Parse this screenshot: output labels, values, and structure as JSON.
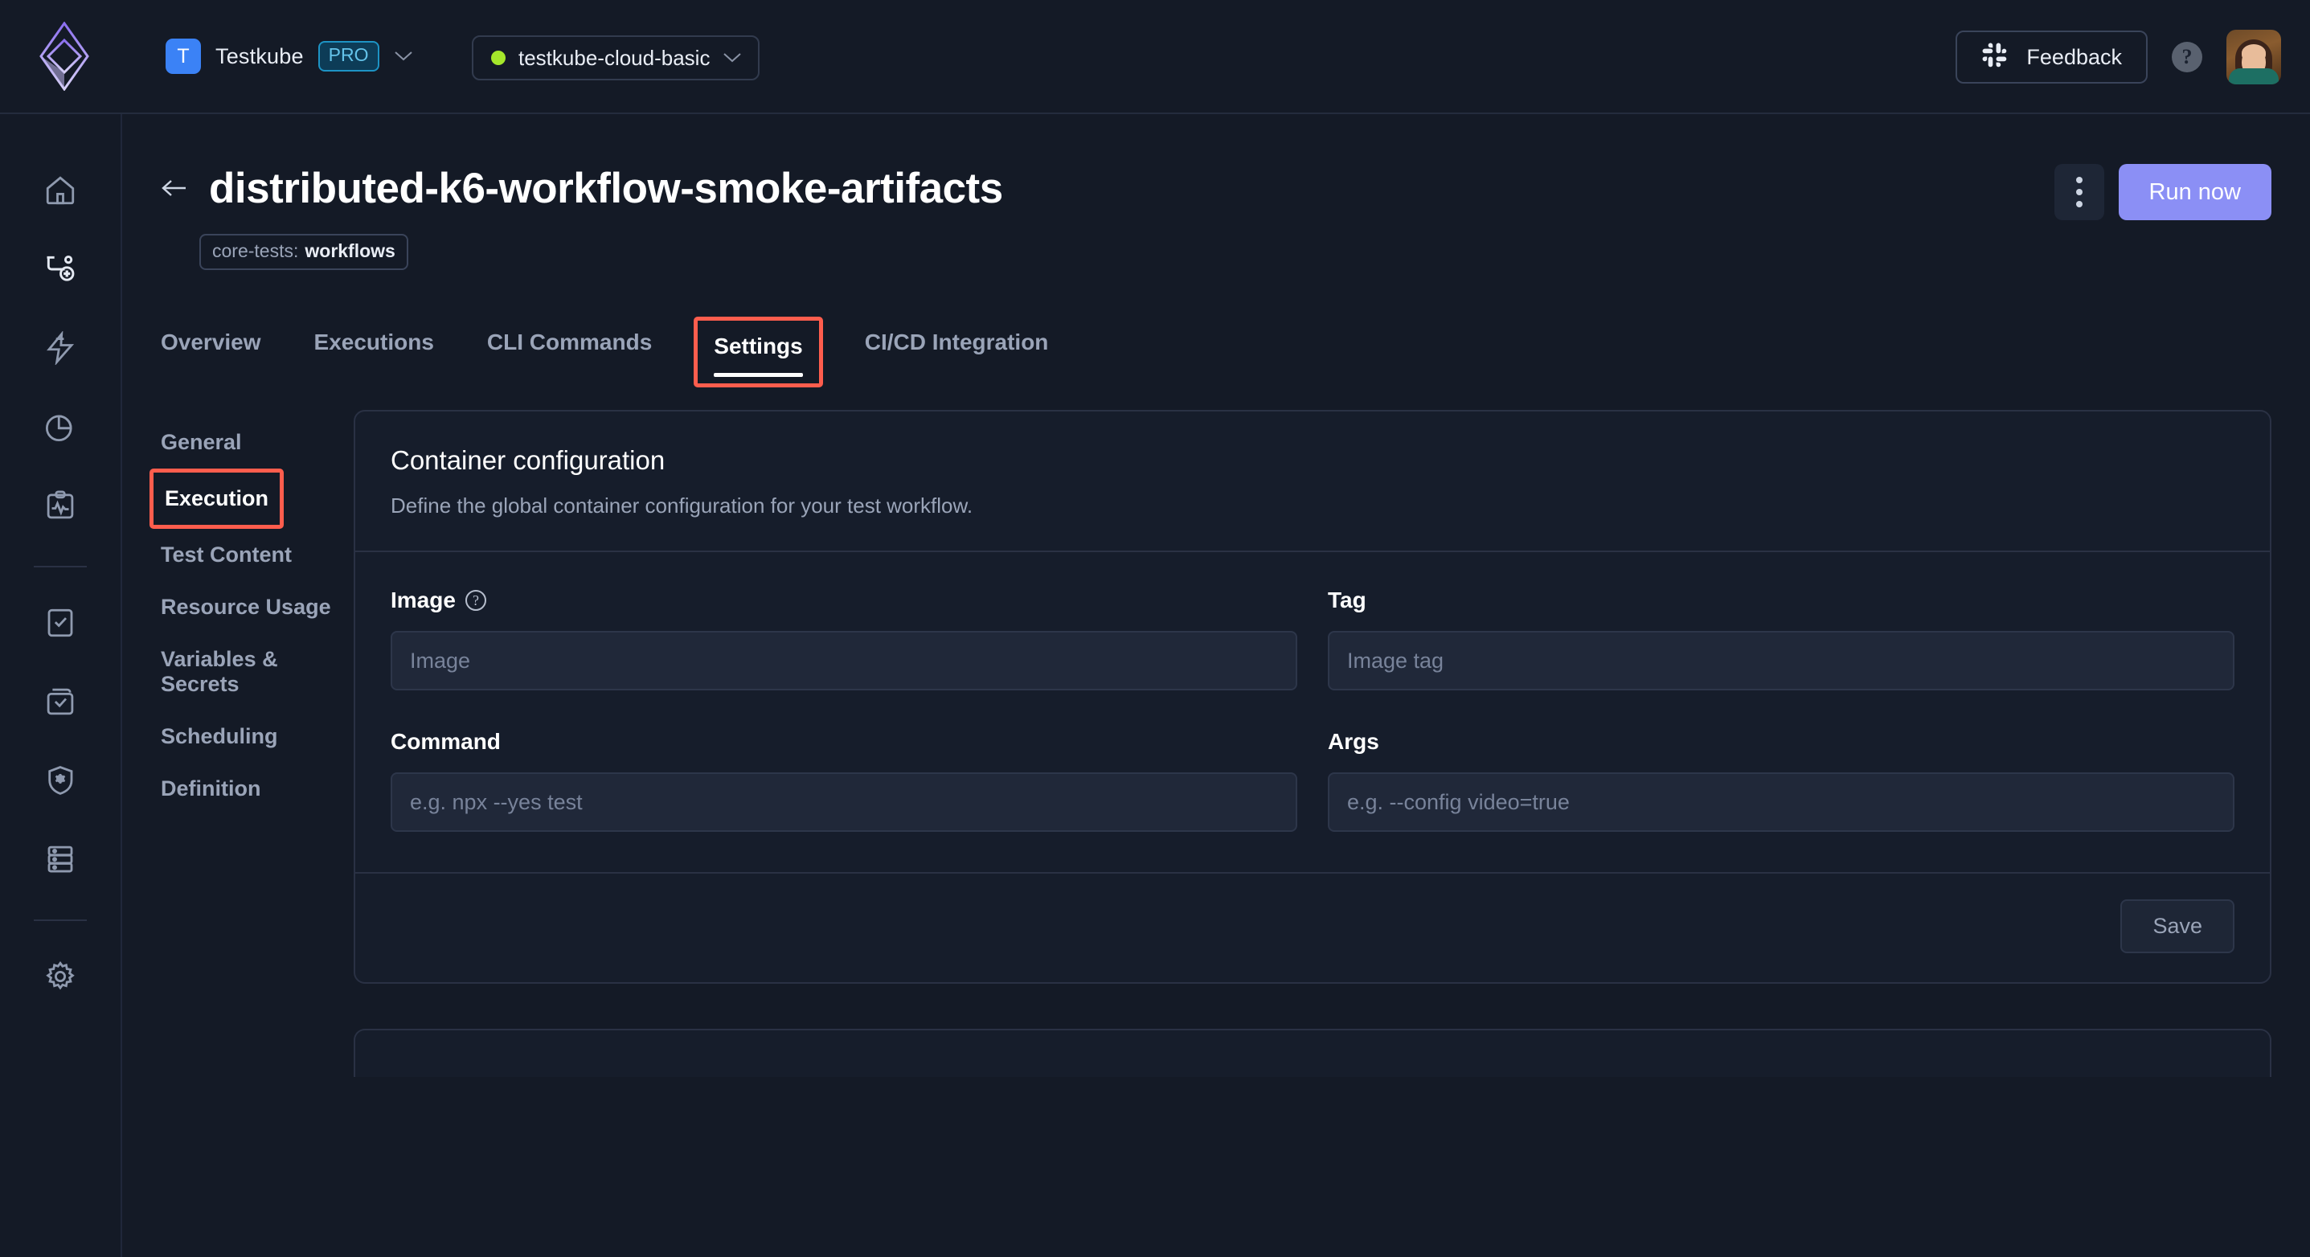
{
  "topbar": {
    "logo_icon": "testkube-diamond-logo",
    "org": {
      "avatar_letter": "T",
      "name": "Testkube",
      "plan_badge": "PRO",
      "chevron_icon": "chevron-down-icon"
    },
    "environment": {
      "status_icon": "status-dot-green",
      "name": "testkube-cloud-basic",
      "chevron_icon": "chevron-down-icon",
      "status_color": "#a5e72b"
    },
    "feedback": {
      "icon": "slack-icon",
      "label": "Feedback"
    },
    "help": {
      "icon": "help-question-icon",
      "label": "?"
    },
    "avatar": {
      "icon": "user-avatar"
    }
  },
  "rail": {
    "items": [
      {
        "name": "home-icon",
        "label": "Home"
      },
      {
        "name": "create-workflow-icon",
        "label": "Create workflow"
      },
      {
        "name": "triggers-lightning-icon",
        "label": "Triggers"
      },
      {
        "name": "insights-pie-chart-icon",
        "label": "Insights"
      },
      {
        "name": "test-report-clipboard-icon",
        "label": "Reports"
      },
      {
        "name": "workflows-file-icon",
        "label": "Workflows"
      },
      {
        "name": "test-suites-box-icon",
        "label": "Test suites"
      },
      {
        "name": "security-shield-icon",
        "label": "Security"
      },
      {
        "name": "resources-server-icon",
        "label": "Resources"
      },
      {
        "name": "settings-gear-icon",
        "label": "Settings"
      }
    ],
    "divider_after": [
      4,
      8
    ]
  },
  "page": {
    "back_icon": "back-arrow-icon",
    "title": "distributed-k6-workflow-smoke-artifacts",
    "label_chip": {
      "key": "core-tests:",
      "value": "workflows"
    },
    "kebab_icon": "more-options-icon",
    "run_button": "Run now",
    "tabs": [
      {
        "label": "Overview",
        "active": false,
        "highlighted": false
      },
      {
        "label": "Executions",
        "active": false,
        "highlighted": false
      },
      {
        "label": "CLI Commands",
        "active": false,
        "highlighted": false
      },
      {
        "label": "Settings",
        "active": true,
        "highlighted": true
      },
      {
        "label": "CI/CD Integration",
        "active": false,
        "highlighted": false
      }
    ],
    "subnav": [
      {
        "label": "General",
        "active": false,
        "highlighted": false
      },
      {
        "label": "Execution",
        "active": true,
        "highlighted": true
      },
      {
        "label": "Test Content",
        "active": false,
        "highlighted": false
      },
      {
        "label": "Resource Usage",
        "active": false,
        "highlighted": false
      },
      {
        "label": "Variables & Secrets",
        "active": false,
        "highlighted": false
      },
      {
        "label": "Scheduling",
        "active": false,
        "highlighted": false
      },
      {
        "label": "Definition",
        "active": false,
        "highlighted": false
      }
    ],
    "highlight_color": "#ff5d4d"
  },
  "container_card": {
    "title": "Container configuration",
    "subtitle": "Define the global container configuration for your test workflow.",
    "fields": {
      "image": {
        "label": "Image",
        "help_icon": "help-question-icon",
        "value": "",
        "placeholder": "Image"
      },
      "tag": {
        "label": "Tag",
        "value": "",
        "placeholder": "Image tag"
      },
      "command": {
        "label": "Command",
        "value": "",
        "placeholder": "e.g. npx --yes test"
      },
      "args": {
        "label": "Args",
        "value": "",
        "placeholder": "e.g. --config video=true"
      }
    },
    "save_label": "Save"
  }
}
